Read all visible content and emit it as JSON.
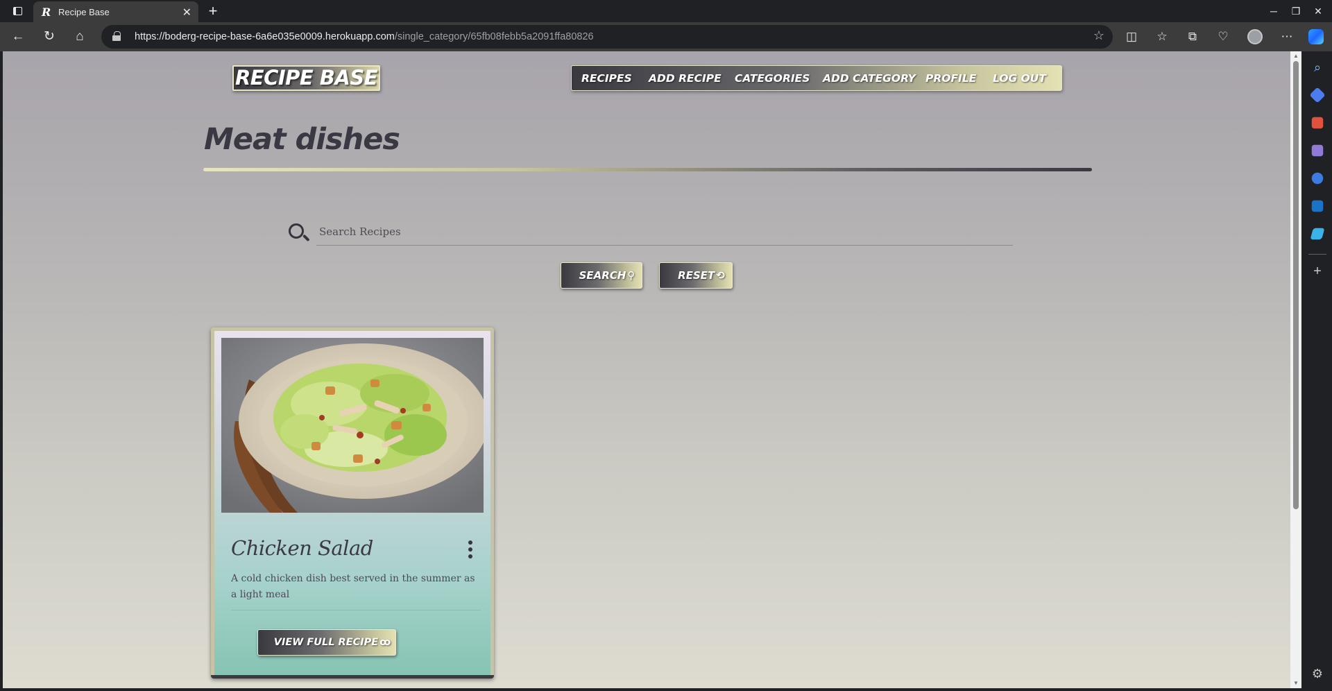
{
  "browser": {
    "tab_title": "Recipe Base",
    "tab_favicon": "R",
    "url_host": "https://boderg-recipe-base-6a6e035e0009.herokuapp.com",
    "url_path": "/single_category/65fb08febb5a2091ffa80826"
  },
  "site": {
    "logo": "RECIPE BASE",
    "nav": [
      "RECIPES",
      "ADD RECIPE",
      "CATEGORIES",
      "ADD CATEGORY",
      "PROFILE",
      "LOG OUT"
    ]
  },
  "page": {
    "title": "Meat dishes",
    "search_placeholder": "Search Recipes",
    "search_button": "SEARCH",
    "reset_button": "RESET"
  },
  "recipes": [
    {
      "title": "Chicken Salad",
      "description": "A cold chicken dish best served in the summer as a light meal",
      "button": "VIEW FULL RECIPE"
    }
  ],
  "colors": {
    "accent_dark": "#3a3940",
    "accent_light": "#e4e1b4",
    "card_teal": "#86c4b3"
  }
}
